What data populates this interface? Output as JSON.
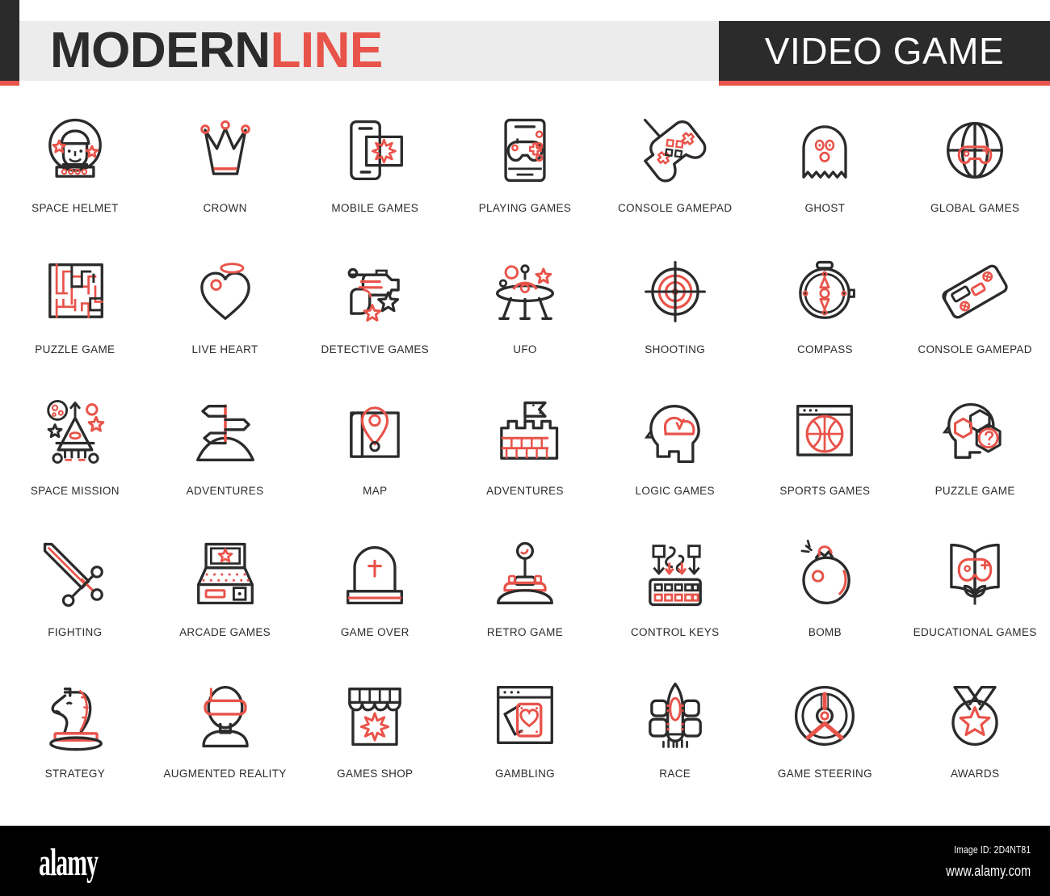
{
  "header": {
    "title_dark": "MODERN",
    "title_red": "LINE",
    "badge": "VIDEO GAME"
  },
  "colors": {
    "dark": "#2b2b2b",
    "red": "#e8534a",
    "band": "#ececec",
    "page": "#ffffff",
    "footer": "#000000"
  },
  "icons": [
    {
      "id": "space-helmet",
      "label": "SPACE HELMET"
    },
    {
      "id": "crown",
      "label": "CROWN"
    },
    {
      "id": "mobile-games",
      "label": "MOBILE GAMES"
    },
    {
      "id": "playing-games",
      "label": "PLAYING GAMES"
    },
    {
      "id": "console-gamepad",
      "label": "CONSOLE GAMEPAD"
    },
    {
      "id": "ghost",
      "label": "GHOST"
    },
    {
      "id": "global-games",
      "label": "GLOBAL GAMES"
    },
    {
      "id": "puzzle-game-maze",
      "label": "PUZZLE GAME"
    },
    {
      "id": "live-heart",
      "label": "LIVE HEART"
    },
    {
      "id": "detective-games",
      "label": "DETECTIVE GAMES"
    },
    {
      "id": "ufo",
      "label": "UFO"
    },
    {
      "id": "shooting",
      "label": "SHOOTING"
    },
    {
      "id": "compass",
      "label": "COMPASS"
    },
    {
      "id": "console-gamepad-2",
      "label": "CONSOLE GAMEPAD"
    },
    {
      "id": "space-mission",
      "label": "SPACE MISSION"
    },
    {
      "id": "adventures-sign",
      "label": "ADVENTURES"
    },
    {
      "id": "map",
      "label": "MAP"
    },
    {
      "id": "adventures-castle",
      "label": "ADVENTURES"
    },
    {
      "id": "logic-games",
      "label": "LOGIC GAMES"
    },
    {
      "id": "sports-games",
      "label": "SPORTS GAMES"
    },
    {
      "id": "puzzle-game-head",
      "label": "PUZZLE GAME"
    },
    {
      "id": "fighting",
      "label": "FIGHTING"
    },
    {
      "id": "arcade-games",
      "label": "ARCADE GAMES"
    },
    {
      "id": "game-over",
      "label": "GAME OVER"
    },
    {
      "id": "retro-game",
      "label": "RETRO GAME"
    },
    {
      "id": "control-keys",
      "label": "CONTROL KEYS"
    },
    {
      "id": "bomb",
      "label": "BOMB"
    },
    {
      "id": "educational-games",
      "label": "EDUCATIONAL GAMES"
    },
    {
      "id": "strategy",
      "label": "STRATEGY"
    },
    {
      "id": "augmented-reality",
      "label": "AUGMENTED REALITY"
    },
    {
      "id": "games-shop",
      "label": "GAMES SHOP"
    },
    {
      "id": "gambling",
      "label": "GAMBLING"
    },
    {
      "id": "race",
      "label": "RACE"
    },
    {
      "id": "game-steering",
      "label": "GAME STEERING"
    },
    {
      "id": "awards",
      "label": "AWARDS"
    }
  ],
  "footer": {
    "logo": "alamy",
    "image_id": "Image ID: 2D4NT81",
    "url": "www.alamy.com"
  }
}
